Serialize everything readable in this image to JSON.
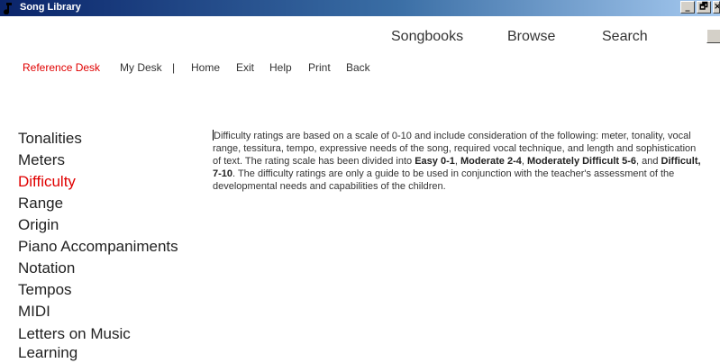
{
  "window": {
    "title": "Song Library",
    "controls": [
      "_",
      "🗗",
      "×"
    ]
  },
  "top_nav": [
    "Songbooks",
    "Browse",
    "Search"
  ],
  "sub_nav": {
    "items": [
      "Reference Desk",
      "My Desk",
      "Home",
      "Exit",
      "Help",
      "Print",
      "Back"
    ],
    "separator": "|",
    "active": "Reference Desk"
  },
  "sidebar": {
    "items": [
      "Tonalities",
      "Meters",
      "Difficulty",
      "Range",
      "Origin",
      "Piano Accompaniments",
      "Notation",
      "Tempos",
      "MIDI",
      "Letters on Music Learning"
    ],
    "active": "Difficulty"
  },
  "content": {
    "p1": "Difficulty ratings are based on a scale of 0-10 and include consideration of the following: meter, tonality, vocal range, tessitura, tempo, expressive needs of the song, required vocal technique, and length and sophistication of text.  The rating scale has been divided into ",
    "b1": "Easy 0-1",
    "c1": ", ",
    "b2": "Moderate 2-4",
    "c2": ", ",
    "b3": "Moderately Difficult 5-6",
    "c3": ", and ",
    "b4": "Difficult, 7-10",
    "p2": ".  The difficulty ratings are only a guide to be used in conjunction with the teacher's assessment of the developmental needs and capabilities of the children."
  },
  "colors": {
    "titlebar_start": "#0a246a",
    "titlebar_end": "#a6caf0",
    "active": "#e00000"
  }
}
